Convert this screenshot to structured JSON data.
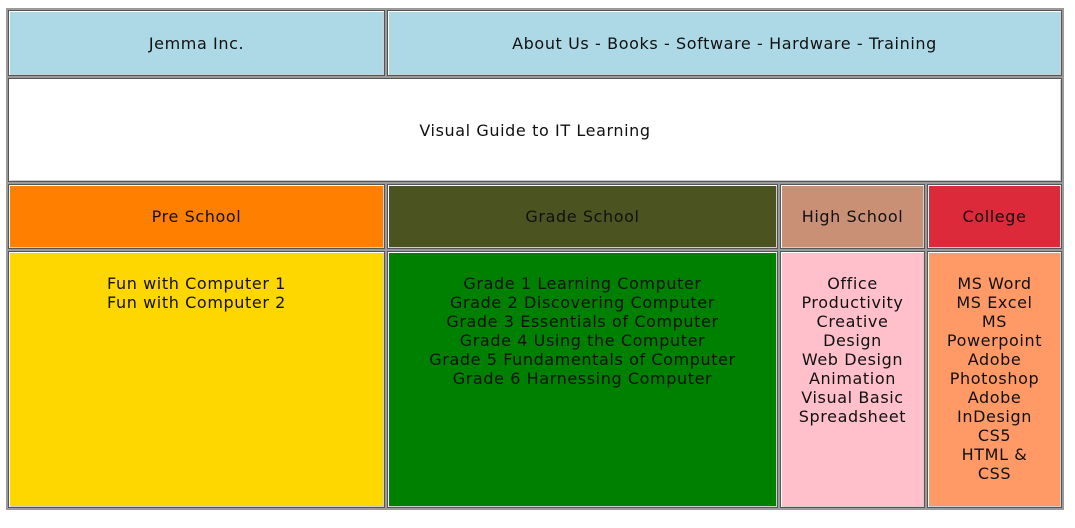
{
  "header": {
    "brand": "Jemma Inc.",
    "nav": [
      "About Us",
      "Books",
      "Software",
      "Hardware",
      "Training"
    ],
    "separator": " - ",
    "bg_color": "#add8e6"
  },
  "banner": {
    "title": "Visual Guide to IT Learning",
    "bg_color": "#ffffff"
  },
  "columns": [
    {
      "heading": "Pre School",
      "heading_bg": "#ff8000",
      "body_bg": "#ffd700",
      "items": [
        "Fun with Computer 1",
        "Fun with Computer 2"
      ]
    },
    {
      "heading": "Grade School",
      "heading_bg": "#4b5320",
      "body_bg": "#008000",
      "items": [
        "Grade 1 Learning Computer",
        "Grade 2 Discovering Computer",
        "Grade 3 Essentials of Computer",
        "Grade 4 Using the Computer",
        "Grade 5 Fundamentals of Computer",
        "Grade 6 Harnessing Computer"
      ]
    },
    {
      "heading": "High School",
      "heading_bg": "#c99076",
      "body_bg": "#ffc0cb",
      "items": [
        "Office",
        "Productivity",
        "Creative",
        "Design",
        "Web Design",
        "Animation",
        "Visual Basic",
        "Spreadsheet"
      ]
    },
    {
      "heading": "College",
      "heading_bg": "#dc2a3a",
      "body_bg": "#ff9966",
      "items": [
        "MS Word",
        "MS Excel",
        "MS",
        "Powerpoint",
        "Adobe",
        "Photoshop",
        "Adobe",
        "InDesign",
        "CS5",
        "HTML &",
        "CSS"
      ]
    }
  ]
}
